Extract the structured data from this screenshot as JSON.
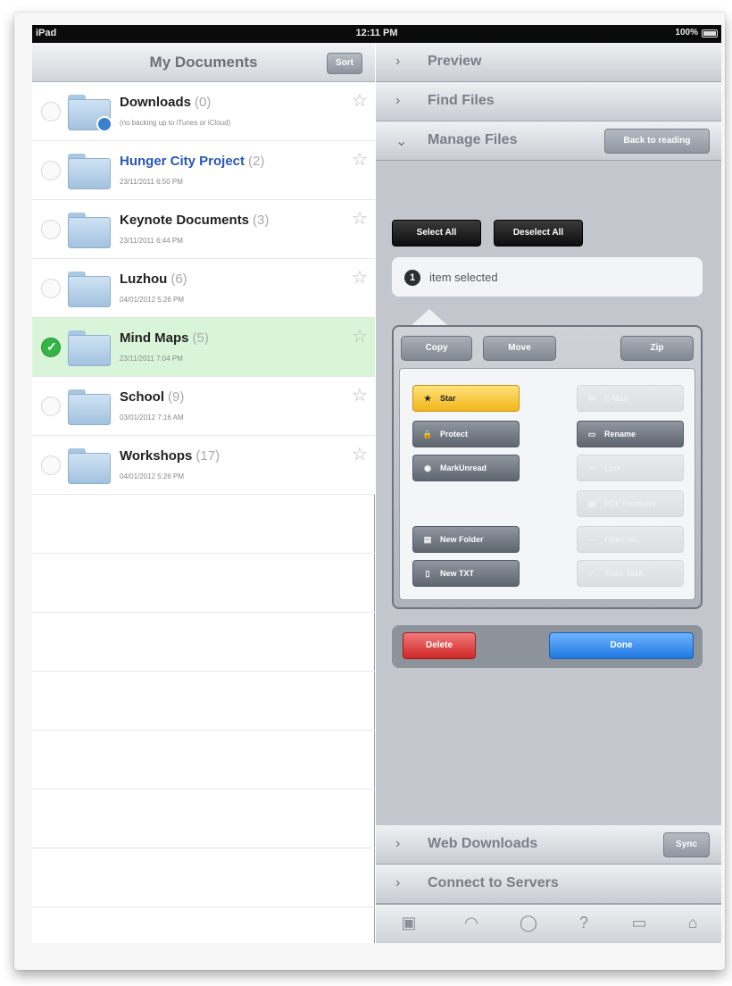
{
  "status_bar": {
    "device": "iPad",
    "time": "12:11 PM",
    "battery": "100%"
  },
  "left": {
    "title": "My Documents",
    "sort_label": "Sort",
    "documents": [
      {
        "name": "Downloads",
        "count": "(0)",
        "subtitle": "(no backing up to iTunes or iCloud)",
        "blue": false,
        "selected": false
      },
      {
        "name": "Hunger City Project",
        "count": "(2)",
        "subtitle": "23/11/2011 6:50 PM",
        "blue": true,
        "selected": false
      },
      {
        "name": "Keynote Documents",
        "count": "(3)",
        "subtitle": "23/11/2011 6:44 PM",
        "blue": false,
        "selected": false
      },
      {
        "name": "Luzhou",
        "count": "(6)",
        "subtitle": "04/01/2012 5:26 PM",
        "blue": false,
        "selected": false
      },
      {
        "name": "Mind Maps",
        "count": "(5)",
        "subtitle": "23/11/2011 7:04 PM",
        "blue": false,
        "selected": true
      },
      {
        "name": "School",
        "count": "(9)",
        "subtitle": "03/01/2012 7:16 AM",
        "blue": false,
        "selected": false
      },
      {
        "name": "Workshops",
        "count": "(17)",
        "subtitle": "04/01/2012 5:26 PM",
        "blue": false,
        "selected": false
      }
    ]
  },
  "right": {
    "sections": {
      "preview": "Preview",
      "find_files": "Find Files",
      "manage_files": "Manage Files",
      "web_downloads": "Web Downloads",
      "connect_servers": "Connect to Servers"
    },
    "back_to_reading": "Back to reading",
    "sync_label": "Sync",
    "select_all": "Select All",
    "deselect_all": "Deselect All",
    "selected_count": "1",
    "selected_text": "item selected",
    "top_actions": {
      "copy": "Copy",
      "move": "Move",
      "zip": "Zip"
    },
    "actions": {
      "star": "Star",
      "protect": "Protect",
      "mark_unread": "MarkUnread",
      "new_folder": "New Folder",
      "new_txt": "New TXT",
      "email": "E-Mail",
      "rename": "Rename",
      "link": "Link",
      "pdf_portfolio": "PDF Portfolio",
      "open_in": "Open In...",
      "todo_task": "Todo Task"
    },
    "delete_label": "Delete",
    "done_label": "Done"
  },
  "colors": {
    "selected_row": "#d9f5d9",
    "star_button": "#f2b61b",
    "delete_button": "#cf2727",
    "done_button": "#1f78e0"
  }
}
